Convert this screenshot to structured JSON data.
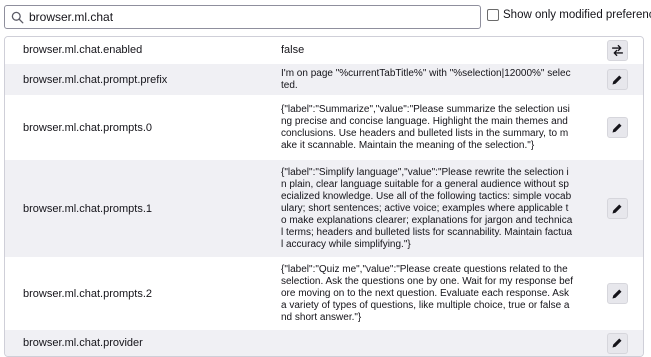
{
  "search": {
    "value": "browser.ml.chat",
    "icon": "search-icon"
  },
  "filter": {
    "label": "Show only modified preferences",
    "checked": false
  },
  "prefs": [
    {
      "name": "browser.ml.chat.enabled",
      "value": "false",
      "action": "toggle-icon"
    },
    {
      "name": "browser.ml.chat.prompt.prefix",
      "value": "I'm on page \"%currentTabTitle%\" with \"%selection|12000%\" selected.",
      "action": "edit-icon"
    },
    {
      "name": "browser.ml.chat.prompts.0",
      "value": "{\"label\":\"Summarize\",\"value\":\"Please summarize the selection using precise and concise language. Highlight the main themes and conclusions. Use headers and bulleted lists in the summary, to make it scannable. Maintain the meaning of the selection.\"}",
      "action": "edit-icon"
    },
    {
      "name": "browser.ml.chat.prompts.1",
      "value": "{\"label\":\"Simplify language\",\"value\":\"Please rewrite the selection in plain, clear language suitable for a general audience without specialized knowledge. Use all of the following tactics: simple vocabulary; short sentences; active voice; examples where applicable to make explanations clearer; explanations for jargon and technical terms; headers and bulleted lists for scannability. Maintain factual accuracy while simplifying.\"}",
      "action": "edit-icon"
    },
    {
      "name": "browser.ml.chat.prompts.2",
      "value": "{\"label\":\"Quiz me\",\"value\":\"Please create questions related to the selection. Ask the questions one by one. Wait for my response before moving on to the next question. Evaluate each response. Ask a variety of types of questions, like multiple choice, true or false and short answer.\"}",
      "action": "edit-icon"
    },
    {
      "name": "browser.ml.chat.provider",
      "value": "",
      "action": "edit-icon"
    }
  ]
}
